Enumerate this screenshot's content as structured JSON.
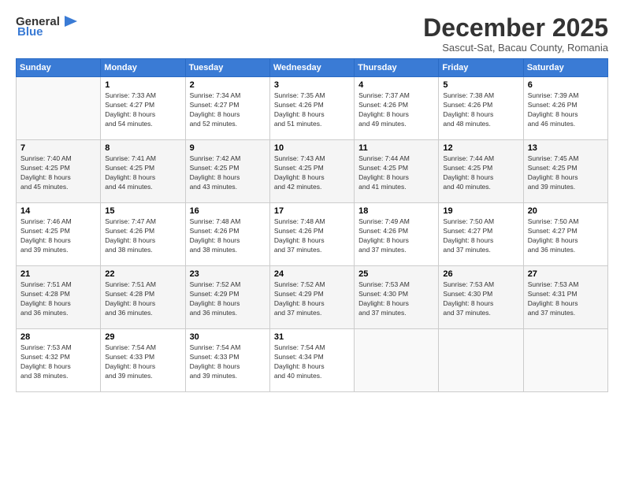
{
  "logo": {
    "line1": "General",
    "line2": "Blue"
  },
  "title": "December 2025",
  "subtitle": "Sascut-Sat, Bacau County, Romania",
  "header_days": [
    "Sunday",
    "Monday",
    "Tuesday",
    "Wednesday",
    "Thursday",
    "Friday",
    "Saturday"
  ],
  "weeks": [
    [
      {
        "day": "",
        "info": ""
      },
      {
        "day": "1",
        "info": "Sunrise: 7:33 AM\nSunset: 4:27 PM\nDaylight: 8 hours\nand 54 minutes."
      },
      {
        "day": "2",
        "info": "Sunrise: 7:34 AM\nSunset: 4:27 PM\nDaylight: 8 hours\nand 52 minutes."
      },
      {
        "day": "3",
        "info": "Sunrise: 7:35 AM\nSunset: 4:26 PM\nDaylight: 8 hours\nand 51 minutes."
      },
      {
        "day": "4",
        "info": "Sunrise: 7:37 AM\nSunset: 4:26 PM\nDaylight: 8 hours\nand 49 minutes."
      },
      {
        "day": "5",
        "info": "Sunrise: 7:38 AM\nSunset: 4:26 PM\nDaylight: 8 hours\nand 48 minutes."
      },
      {
        "day": "6",
        "info": "Sunrise: 7:39 AM\nSunset: 4:26 PM\nDaylight: 8 hours\nand 46 minutes."
      }
    ],
    [
      {
        "day": "7",
        "info": "Sunrise: 7:40 AM\nSunset: 4:25 PM\nDaylight: 8 hours\nand 45 minutes."
      },
      {
        "day": "8",
        "info": "Sunrise: 7:41 AM\nSunset: 4:25 PM\nDaylight: 8 hours\nand 44 minutes."
      },
      {
        "day": "9",
        "info": "Sunrise: 7:42 AM\nSunset: 4:25 PM\nDaylight: 8 hours\nand 43 minutes."
      },
      {
        "day": "10",
        "info": "Sunrise: 7:43 AM\nSunset: 4:25 PM\nDaylight: 8 hours\nand 42 minutes."
      },
      {
        "day": "11",
        "info": "Sunrise: 7:44 AM\nSunset: 4:25 PM\nDaylight: 8 hours\nand 41 minutes."
      },
      {
        "day": "12",
        "info": "Sunrise: 7:44 AM\nSunset: 4:25 PM\nDaylight: 8 hours\nand 40 minutes."
      },
      {
        "day": "13",
        "info": "Sunrise: 7:45 AM\nSunset: 4:25 PM\nDaylight: 8 hours\nand 39 minutes."
      }
    ],
    [
      {
        "day": "14",
        "info": "Sunrise: 7:46 AM\nSunset: 4:25 PM\nDaylight: 8 hours\nand 39 minutes."
      },
      {
        "day": "15",
        "info": "Sunrise: 7:47 AM\nSunset: 4:26 PM\nDaylight: 8 hours\nand 38 minutes."
      },
      {
        "day": "16",
        "info": "Sunrise: 7:48 AM\nSunset: 4:26 PM\nDaylight: 8 hours\nand 38 minutes."
      },
      {
        "day": "17",
        "info": "Sunrise: 7:48 AM\nSunset: 4:26 PM\nDaylight: 8 hours\nand 37 minutes."
      },
      {
        "day": "18",
        "info": "Sunrise: 7:49 AM\nSunset: 4:26 PM\nDaylight: 8 hours\nand 37 minutes."
      },
      {
        "day": "19",
        "info": "Sunrise: 7:50 AM\nSunset: 4:27 PM\nDaylight: 8 hours\nand 37 minutes."
      },
      {
        "day": "20",
        "info": "Sunrise: 7:50 AM\nSunset: 4:27 PM\nDaylight: 8 hours\nand 36 minutes."
      }
    ],
    [
      {
        "day": "21",
        "info": "Sunrise: 7:51 AM\nSunset: 4:28 PM\nDaylight: 8 hours\nand 36 minutes."
      },
      {
        "day": "22",
        "info": "Sunrise: 7:51 AM\nSunset: 4:28 PM\nDaylight: 8 hours\nand 36 minutes."
      },
      {
        "day": "23",
        "info": "Sunrise: 7:52 AM\nSunset: 4:29 PM\nDaylight: 8 hours\nand 36 minutes."
      },
      {
        "day": "24",
        "info": "Sunrise: 7:52 AM\nSunset: 4:29 PM\nDaylight: 8 hours\nand 37 minutes."
      },
      {
        "day": "25",
        "info": "Sunrise: 7:53 AM\nSunset: 4:30 PM\nDaylight: 8 hours\nand 37 minutes."
      },
      {
        "day": "26",
        "info": "Sunrise: 7:53 AM\nSunset: 4:30 PM\nDaylight: 8 hours\nand 37 minutes."
      },
      {
        "day": "27",
        "info": "Sunrise: 7:53 AM\nSunset: 4:31 PM\nDaylight: 8 hours\nand 37 minutes."
      }
    ],
    [
      {
        "day": "28",
        "info": "Sunrise: 7:53 AM\nSunset: 4:32 PM\nDaylight: 8 hours\nand 38 minutes."
      },
      {
        "day": "29",
        "info": "Sunrise: 7:54 AM\nSunset: 4:33 PM\nDaylight: 8 hours\nand 39 minutes."
      },
      {
        "day": "30",
        "info": "Sunrise: 7:54 AM\nSunset: 4:33 PM\nDaylight: 8 hours\nand 39 minutes."
      },
      {
        "day": "31",
        "info": "Sunrise: 7:54 AM\nSunset: 4:34 PM\nDaylight: 8 hours\nand 40 minutes."
      },
      {
        "day": "",
        "info": ""
      },
      {
        "day": "",
        "info": ""
      },
      {
        "day": "",
        "info": ""
      }
    ]
  ]
}
